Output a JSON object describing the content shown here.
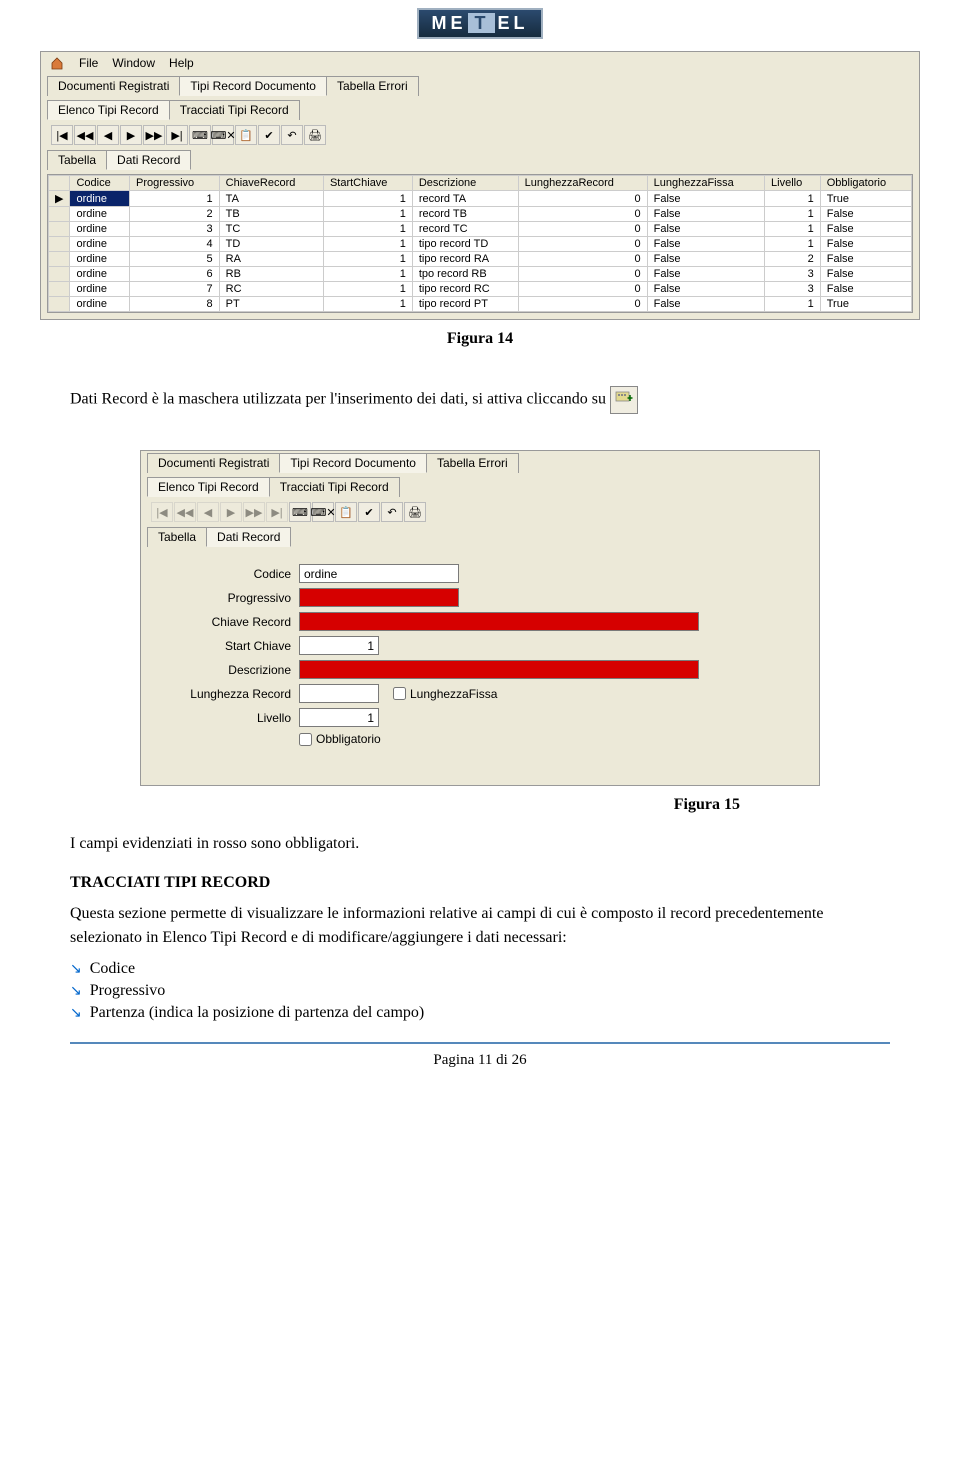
{
  "logo": {
    "text_left": "ME",
    "text_mid": "T",
    "text_right": "EL"
  },
  "screenshot1": {
    "menu": [
      "File",
      "Window",
      "Help"
    ],
    "tabs_l1": [
      {
        "label": "Documenti Registrati",
        "active": false
      },
      {
        "label": "Tipi Record Documento",
        "active": true
      },
      {
        "label": "Tabella Errori",
        "active": false
      }
    ],
    "tabs_l2": [
      {
        "label": "Elenco Tipi Record",
        "active": true
      },
      {
        "label": "Tracciati Tipi Record",
        "active": false
      }
    ],
    "toolbar_icons": [
      "|◀",
      "◀◀",
      "◀",
      "▶",
      "▶▶",
      "▶|",
      "⌨",
      "⌨✕",
      "📋",
      "✔",
      "↶",
      "🖨"
    ],
    "tabs_l3": [
      {
        "label": "Tabella",
        "active": false
      },
      {
        "label": "Dati Record",
        "active": true
      }
    ],
    "columns": [
      "Codice",
      "Progressivo",
      "ChiaveRecord",
      "StartChiave",
      "Descrizione",
      "LunghezzaRecord",
      "LunghezzaFissa",
      "Livello",
      "Obbligatorio"
    ],
    "rows": [
      {
        "sel": true,
        "cells": [
          "ordine",
          "1",
          "TA",
          "1",
          "record TA",
          "0",
          "False",
          "1",
          "True"
        ]
      },
      {
        "sel": false,
        "cells": [
          "ordine",
          "2",
          "TB",
          "1",
          "record TB",
          "0",
          "False",
          "1",
          "False"
        ]
      },
      {
        "sel": false,
        "cells": [
          "ordine",
          "3",
          "TC",
          "1",
          "record TC",
          "0",
          "False",
          "1",
          "False"
        ]
      },
      {
        "sel": false,
        "cells": [
          "ordine",
          "4",
          "TD",
          "1",
          "tipo record TD",
          "0",
          "False",
          "1",
          "False"
        ]
      },
      {
        "sel": false,
        "cells": [
          "ordine",
          "5",
          "RA",
          "1",
          "tipo record RA",
          "0",
          "False",
          "2",
          "False"
        ]
      },
      {
        "sel": false,
        "cells": [
          "ordine",
          "6",
          "RB",
          "1",
          "tpo record RB",
          "0",
          "False",
          "3",
          "False"
        ]
      },
      {
        "sel": false,
        "cells": [
          "ordine",
          "7",
          "RC",
          "1",
          "tipo record RC",
          "0",
          "False",
          "3",
          "False"
        ]
      },
      {
        "sel": false,
        "cells": [
          "ordine",
          "8",
          "PT",
          "1",
          "tipo record PT",
          "0",
          "False",
          "1",
          "True"
        ]
      }
    ]
  },
  "caption1": "Figura 14",
  "para1_pre": "Dati Record è la maschera utilizzata per l'inserimento dei dati, si attiva cliccando su",
  "screenshot2": {
    "tabs_l1": [
      {
        "label": "Documenti Registrati",
        "active": false
      },
      {
        "label": "Tipi Record Documento",
        "active": true
      },
      {
        "label": "Tabella Errori",
        "active": false
      }
    ],
    "tabs_l2": [
      {
        "label": "Elenco Tipi Record",
        "active": true
      },
      {
        "label": "Tracciati Tipi Record",
        "active": false
      }
    ],
    "toolbar_icons": [
      "|◀",
      "◀◀",
      "◀",
      "▶",
      "▶▶",
      "▶|",
      "⌨",
      "⌨✕",
      "📋",
      "✔",
      "↶",
      "🖨"
    ],
    "tabs_l3": [
      {
        "label": "Tabella",
        "active": false
      },
      {
        "label": "Dati Record",
        "active": true
      }
    ],
    "form": {
      "codice": {
        "label": "Codice",
        "value": "ordine",
        "red": false,
        "width": "med"
      },
      "progressivo": {
        "label": "Progressivo",
        "value": "",
        "red": true,
        "width": "med"
      },
      "chiave_record": {
        "label": "Chiave Record",
        "value": "",
        "red": true,
        "width": "long"
      },
      "start_chiave": {
        "label": "Start Chiave",
        "value": "1",
        "red": false,
        "width": "short"
      },
      "descrizione": {
        "label": "Descrizione",
        "value": "",
        "red": true,
        "width": "long"
      },
      "lunghezza_record": {
        "label": "Lunghezza Record",
        "value": "",
        "red": false,
        "width": "short"
      },
      "lunghezza_fissa_cb": "LunghezzaFissa",
      "livello": {
        "label": "Livello",
        "value": "1",
        "red": false,
        "width": "short"
      },
      "obbligatorio_cb": "Obbligatorio"
    }
  },
  "caption2": "Figura 15",
  "para2": "I campi evidenziati in rosso sono obbligatori.",
  "heading": "TRACCIATI TIPI RECORD",
  "para3": "Questa sezione permette di visualizzare le informazioni relative ai campi di cui è composto il record precedentemente selezionato in Elenco Tipi Record e di modificare/aggiungere i dati necessari:",
  "bullets": [
    "Codice",
    "Progressivo",
    "Partenza (indica la posizione di partenza del campo)"
  ],
  "footer": "Pagina 11 di 26"
}
